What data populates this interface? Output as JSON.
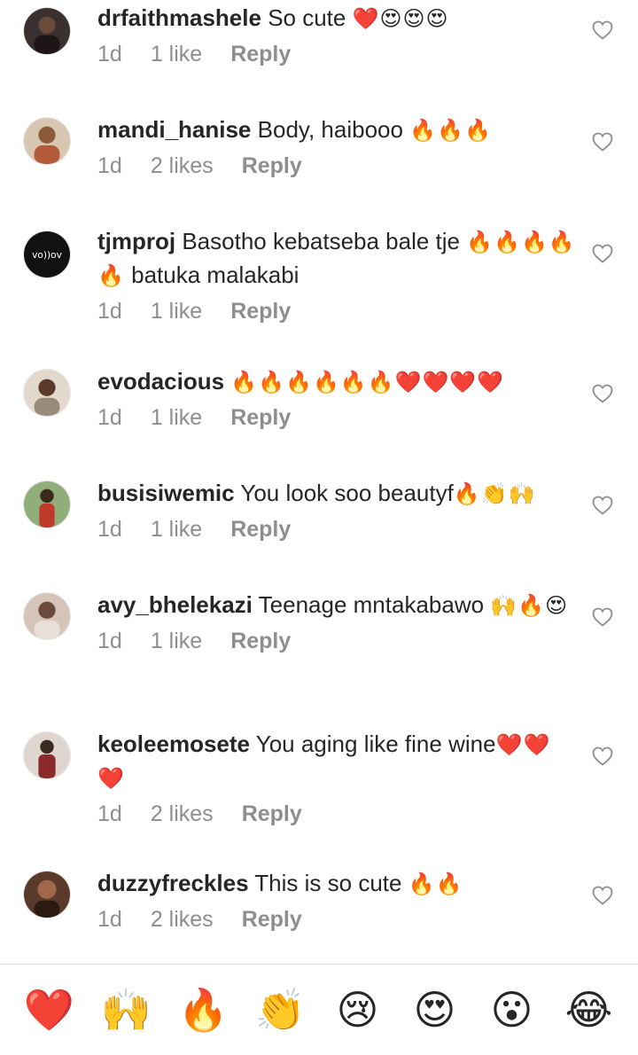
{
  "comments": [
    {
      "username": "drfaithmashele",
      "text": "So cute",
      "emoji": "❤️😍😍😍",
      "text2": "",
      "time": "1d",
      "likes": "1 like",
      "reply": "Reply",
      "avatar_color": "#3a3030"
    },
    {
      "username": "mandi_hanise",
      "text": "Body, haibooo",
      "emoji": "🔥🔥🔥",
      "text2": "",
      "time": "1d",
      "likes": "2 likes",
      "reply": "Reply",
      "avatar_color": "#c9a37a"
    },
    {
      "username": "tjmproj",
      "text": "Basotho kebatseba bale tje",
      "emoji": "🔥🔥🔥🔥🔥",
      "text2": "batuka malakabi",
      "time": "1d",
      "likes": "1 like",
      "reply": "Reply",
      "avatar_color": "#111111"
    },
    {
      "username": "evodacious",
      "text": "",
      "emoji": "🔥🔥🔥🔥🔥🔥❤️❤️❤️❤️",
      "text2": "",
      "time": "1d",
      "likes": "1 like",
      "reply": "Reply",
      "avatar_color": "#cfc2b4"
    },
    {
      "username": "busisiwemic",
      "text": "You look soo beautyf",
      "emoji": "🔥👏🙌",
      "text2": "",
      "time": "1d",
      "likes": "1 like",
      "reply": "Reply",
      "avatar_color": "#6b8a5a"
    },
    {
      "username": "avy_bhelekazi",
      "text": "Teenage mntakabawo",
      "emoji": "🙌🔥😍",
      "text2": "",
      "time": "1d",
      "likes": "1 like",
      "reply": "Reply",
      "avatar_color": "#b89a8a"
    },
    {
      "username": "keoleemosete",
      "text": "You aging like fine",
      "emoji": "❤️❤️❤️",
      "text2": "wine",
      "time": "1d",
      "likes": "2 likes",
      "reply": "Reply",
      "avatar_color": "#8a5c52"
    },
    {
      "username": "duzzyfreckles",
      "text": "This is so cute",
      "emoji": "🔥🔥",
      "text2": "",
      "time": "1d",
      "likes": "2 likes",
      "reply": "Reply",
      "avatar_color": "#4a3024"
    }
  ],
  "reactions": [
    "❤️",
    "🙌",
    "🔥",
    "👏",
    "😢",
    "😍",
    "😮",
    "😂"
  ],
  "colors": {
    "text": "#262626",
    "meta": "#8e8e8e",
    "divider": "#dbdbdb"
  }
}
